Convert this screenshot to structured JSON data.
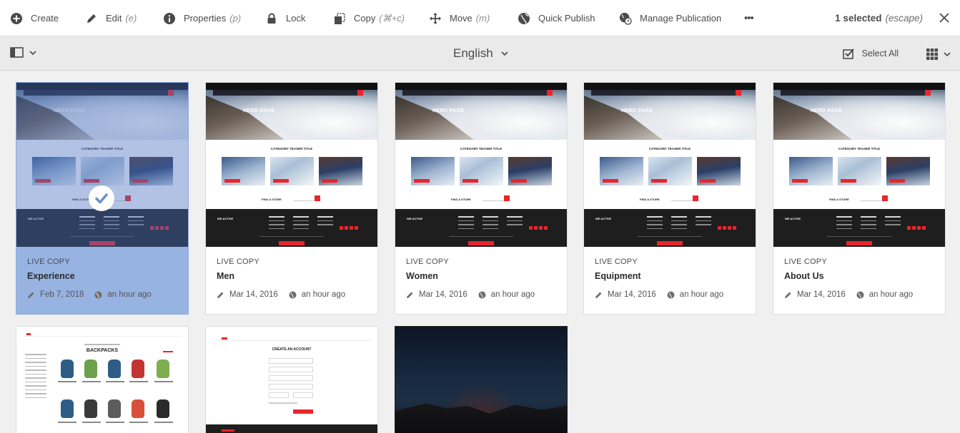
{
  "actionbar": {
    "create": "Create",
    "edit": "Edit",
    "edit_shortcut": "(e)",
    "properties": "Properties",
    "properties_shortcut": "(p)",
    "lock": "Lock",
    "copy": "Copy",
    "copy_shortcut": "(⌘+c)",
    "move": "Move",
    "move_shortcut": "(m)",
    "quick_publish": "Quick Publish",
    "manage_publication": "Manage Publication",
    "more": "•••",
    "selected_count": "1 selected",
    "escape_hint": "(escape)"
  },
  "viewbar": {
    "language": "English",
    "select_all": "Select All"
  },
  "thumb_text": {
    "hero": "HERO PAGE",
    "category": "CATEGORY TEASER TITLE",
    "store": "FIND A STORE",
    "brand": "WE.ACTIVE",
    "backpacks": "BACKPACKS",
    "create_account": "CREATE AN ACCOUNT"
  },
  "cards": [
    {
      "type": "LIVE COPY",
      "title": "Experience",
      "modified": "Feb 7, 2018",
      "published": "an hour ago",
      "selected": true
    },
    {
      "type": "LIVE COPY",
      "title": "Men",
      "modified": "Mar 14, 2016",
      "published": "an hour ago",
      "selected": false
    },
    {
      "type": "LIVE COPY",
      "title": "Women",
      "modified": "Mar 14, 2016",
      "published": "an hour ago",
      "selected": false
    },
    {
      "type": "LIVE COPY",
      "title": "Equipment",
      "modified": "Mar 14, 2016",
      "published": "an hour ago",
      "selected": false
    },
    {
      "type": "LIVE COPY",
      "title": "About Us",
      "modified": "Mar 14, 2016",
      "published": "an hour ago",
      "selected": false
    }
  ],
  "colors": {
    "selected_card": "#97b3e2",
    "brand_red": "#e8262b",
    "background": "#f0f0f0"
  }
}
